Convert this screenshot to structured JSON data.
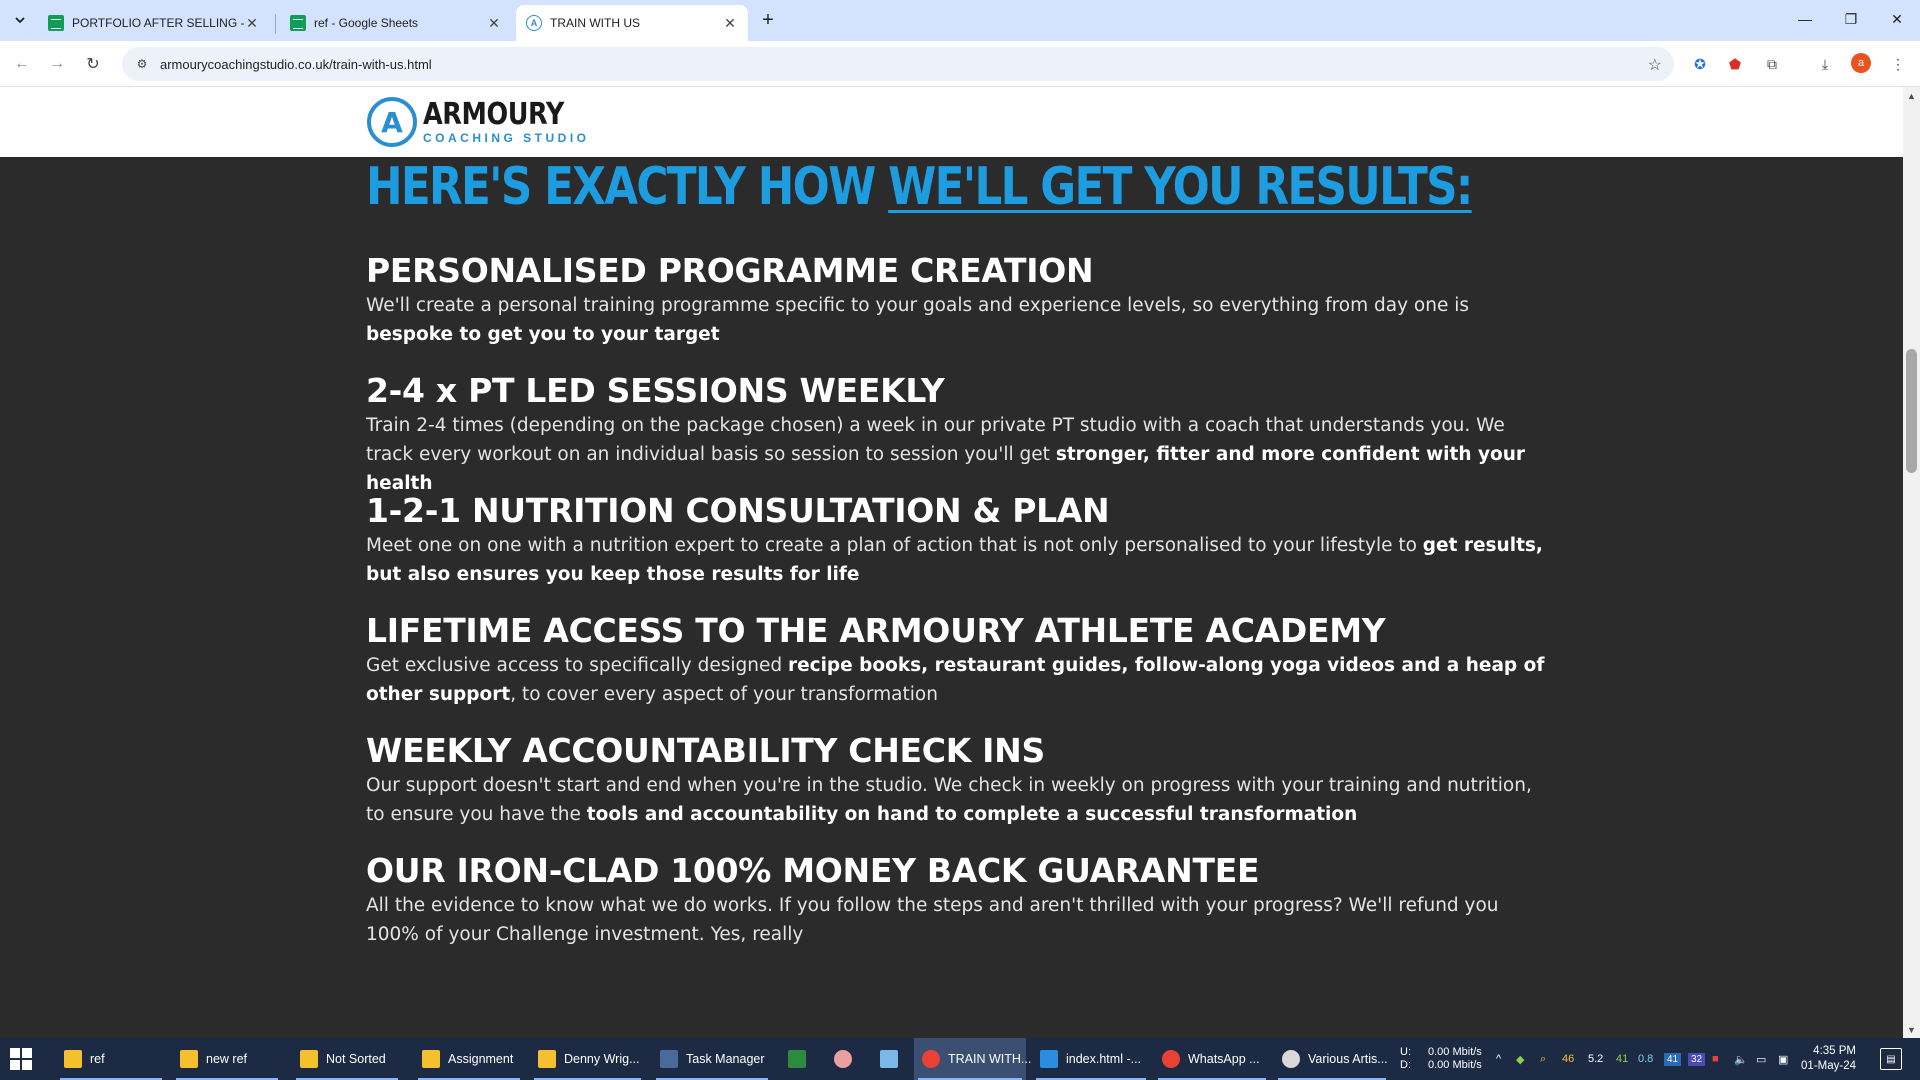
{
  "browser": {
    "tabs": [
      {
        "title": "PORTFOLIO AFTER SELLING - G",
        "icon": "sheets-icon",
        "active": false
      },
      {
        "title": "ref - Google Sheets",
        "icon": "sheets-icon",
        "active": false
      },
      {
        "title": "TRAIN WITH US",
        "icon": "armoury-icon",
        "active": true
      }
    ],
    "url": "armourycoachingstudio.co.uk/train-with-us.html",
    "profile_initial": "a"
  },
  "site": {
    "logo_name": "ARMOURY",
    "logo_sub": "COACHING STUDIO",
    "logo_mark": "A",
    "headline_part1": "HERE'S EXACTLY HOW ",
    "headline_part2": "WE'LL GET YOU RESULTS:",
    "features": [
      {
        "title": "PERSONALISED PROGRAMME CREATION",
        "text": "We'll create a personal training programme specific to your goals and experience levels, so everything from day one is ",
        "bold": "bespoke to get you to your target",
        "tail": ""
      },
      {
        "title": "2-4 x PT LED SESSIONS WEEKLY",
        "text": "Train 2-4 times (depending on the package chosen) a week in our private PT studio with a coach that understands you. We track every workout on an individual basis so session to session you'll get ",
        "bold": "stronger, fitter and more confident with your health",
        "tail": ""
      },
      {
        "title": "1-2-1 NUTRITION CONSULTATION & PLAN",
        "text": "Meet one on one with a nutrition expert to create a plan of action that is not only personalised to your lifestyle to ",
        "bold": "get results, but also ensures you keep those results for life",
        "tail": ""
      },
      {
        "title": "LIFETIME ACCESS TO THE ARMOURY ATHLETE ACADEMY",
        "text": "Get exclusive access to specifically designed ",
        "bold": "recipe books, restaurant guides, follow-along yoga videos and a heap of other support",
        "tail": ", to cover every aspect of your transformation"
      },
      {
        "title": "WEEKLY ACCOUNTABILITY CHECK INS",
        "text": "Our support doesn't start and end when you're in the studio. We check in weekly on progress with your training and nutrition, to ensure you have the ",
        "bold": "tools and accountability on hand to complete a successful transformation",
        "tail": ""
      },
      {
        "title": "OUR IRON-CLAD 100% MONEY BACK GUARANTEE",
        "text": "All the evidence to know what we do works. If you follow the steps and aren't thrilled with your progress? We'll refund you 100% of your Challenge investment. Yes, really",
        "bold": "",
        "tail": ""
      }
    ]
  },
  "taskbar": {
    "items": [
      {
        "label": "ref",
        "icon": "folder-icon"
      },
      {
        "label": "new ref",
        "icon": "folder-icon"
      },
      {
        "label": "Not Sorted",
        "icon": "folder-icon"
      },
      {
        "label": "Assignment",
        "icon": "folder-icon"
      },
      {
        "label": "Denny Wrig...",
        "icon": "folder-icon"
      },
      {
        "label": "Task Manager",
        "icon": "task-manager-icon"
      },
      {
        "label": "TRAIN WITH...",
        "icon": "chrome-icon"
      },
      {
        "label": "index.html -...",
        "icon": "vscode-icon"
      },
      {
        "label": "WhatsApp ...",
        "icon": "chrome-icon"
      },
      {
        "label": "Various Artis...",
        "icon": "app-icon"
      }
    ],
    "net_up_label": "U:",
    "net_down_label": "D:",
    "net_up": "0.00 Mbit/s",
    "net_down": "0.00 Mbit/s",
    "tray_nums": [
      "46",
      "5.2",
      "41",
      "0.8"
    ],
    "tray_badges": [
      "41",
      "32"
    ],
    "time": "4:35 PM",
    "date": "01-May-24"
  },
  "colors": {
    "accent": "#1e9ce0",
    "page_bg": "#2b2b2b",
    "tabbar": "#d3e3fd",
    "taskbar": "#1c2a44"
  }
}
